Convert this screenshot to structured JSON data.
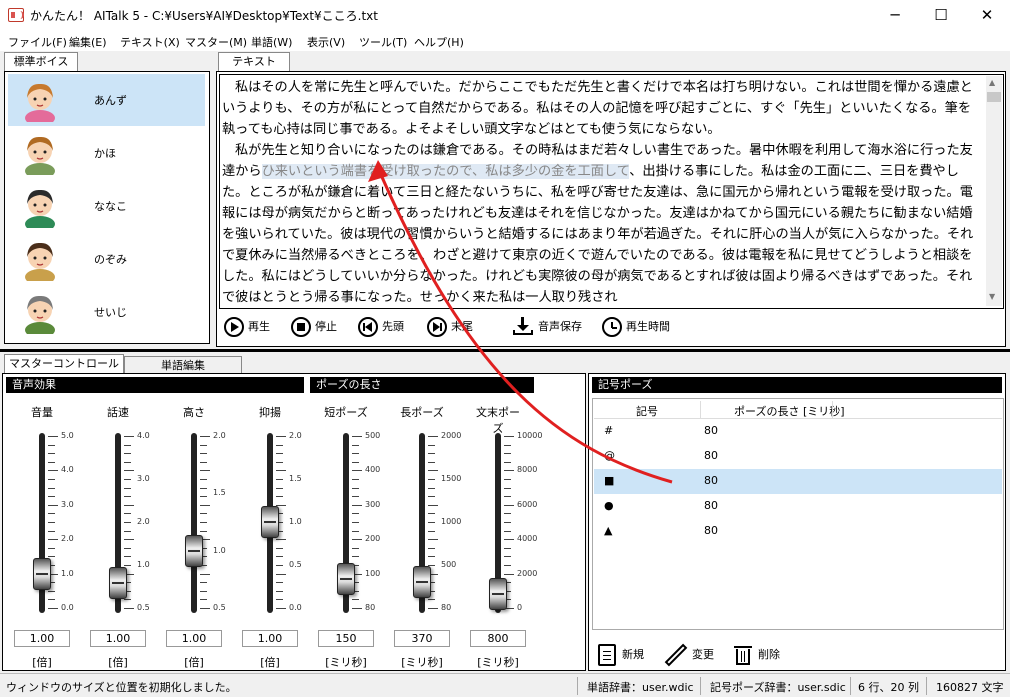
{
  "window": {
    "title": "かんたん！ AITalk 5 - C:¥Users¥AI¥Desktop¥Text¥こころ.txt",
    "app_icon": "speaker-icon",
    "controls": {
      "minimize": "─",
      "maximize": "☐",
      "close": "✕"
    }
  },
  "menu": [
    "ファイル(F)",
    "編集(E)",
    "テキスト(X)",
    "マスター(M)",
    "単語(W)",
    "表示(V)",
    "ツール(T)",
    "ヘルプ(H)"
  ],
  "voice_panel": {
    "tab": "標準ボイス",
    "voices": [
      {
        "name": "あんず",
        "selected": true,
        "hair": "#c77a2e",
        "face": "#f7d3b3",
        "cloth": "#e46b9a"
      },
      {
        "name": "かほ",
        "selected": false,
        "hair": "#b06a22",
        "face": "#f7d3b3",
        "cloth": "#7a9c5a"
      },
      {
        "name": "ななこ",
        "selected": false,
        "hair": "#2a2a2a",
        "face": "#f7d3b3",
        "cloth": "#2e8b57"
      },
      {
        "name": "のぞみ",
        "selected": false,
        "hair": "#4a2e1a",
        "face": "#f7d3b3",
        "cloth": "#c9a04b"
      },
      {
        "name": "せいじ",
        "selected": false,
        "hair": "#7a7a7a",
        "face": "#f7d3b3",
        "cloth": "#5a8a3a"
      }
    ]
  },
  "editor": {
    "tab": "テキスト",
    "paragraphs": [
      "私はその人を常に先生と呼んでいた。だからここでもただ先生と書くだけで本名は打ち明けない。これは世間を憚かる遠慮というよりも、その方が私にとって自然だからである。私はその人の記憶を呼び起すごとに、すぐ「先生」といいたくなる。筆を執っても心持は同じ事である。よそよそしい頭文字などはとても使う気にならない。",
      "私が先生と知り合いになったのは鎌倉である。その時私はまだ若々しい書生であった。暑中休暇を利用して海水浴に行った友達から",
      "ひ来いという端書を受け取ったので、私は多少の金を工面して",
      "、出掛ける事にした。私は金の工面に二、三日を費やした。ところが私が鎌倉に着いて三日と経たないうちに、私を呼び寄せた友達は、急に国元から帰れという電報を受け取った。電報には母が病気だからと断ってあったけれども友達はそれを信じなかった。友達はかねてから国元にいる親たちに勧まない結婚を強いられていた。彼は現代の習慣からいうと結婚するにはあまり年が若過ぎた。それに肝心の当人が気に入らなかった。それで夏休みに当然帰るべきところを、わざと避けて東京の近くで遊んでいたのである。彼は電報を私に見せてどうしようと相談をした。私にはどうしていいか分らなかった。けれども実際彼の母が病気であるとすれば彼は固より帰るべきはずであった。それで彼はとうとう帰る事になった。せっかく来た私は一人取り残され"
    ],
    "controls": [
      {
        "icon": "play-icon",
        "label": "再生"
      },
      {
        "icon": "stop-icon",
        "label": "停止"
      },
      {
        "icon": "skip-back-icon",
        "label": "先頭"
      },
      {
        "icon": "skip-forward-icon",
        "label": "末尾"
      },
      {
        "icon": "download-icon",
        "label": "音声保存"
      },
      {
        "icon": "timer-icon",
        "label": "再生時間"
      }
    ]
  },
  "master": {
    "tabs": [
      "マスターコントロール",
      "単語編集"
    ],
    "voice_effects_title": "音声効果",
    "pause_length_title": "ポーズの長さ",
    "sliders": [
      {
        "label": "音量",
        "value": "1.00",
        "unit": "[倍]",
        "min": 0,
        "max": 5,
        "level": 0.2,
        "scale": [
          "5.0",
          "4.0",
          "3.0",
          "2.0",
          "1.0",
          "0.0"
        ]
      },
      {
        "label": "話速",
        "value": "1.00",
        "unit": "[倍]",
        "min": 0.5,
        "max": 4,
        "level": 0.143,
        "scale": [
          "4.0",
          "3.0",
          "2.0",
          "1.0",
          "0.5"
        ]
      },
      {
        "label": "高さ",
        "value": "1.00",
        "unit": "[倍]",
        "min": 0.5,
        "max": 2,
        "level": 0.333,
        "scale": [
          "2.0",
          "1.5",
          "1.0",
          "0.5"
        ]
      },
      {
        "label": "抑揚",
        "value": "1.00",
        "unit": "[倍]",
        "min": 0,
        "max": 2,
        "level": 0.5,
        "scale": [
          "2.0",
          "1.5",
          "1.0",
          "0.5",
          "0.0"
        ]
      },
      {
        "label": "短ポーズ",
        "value": "150",
        "unit": "[ミリ秒]",
        "min": 80,
        "max": 500,
        "level": 0.167,
        "scale": [
          "500",
          "400",
          "300",
          "200",
          "100",
          "80"
        ]
      },
      {
        "label": "長ポーズ",
        "value": "370",
        "unit": "[ミリ秒]",
        "min": 80,
        "max": 2000,
        "level": 0.151,
        "scale": [
          "2000",
          "1500",
          "1000",
          "500",
          "80"
        ]
      },
      {
        "label": "文末ポーズ",
        "value": "800",
        "unit": "[ミリ秒]",
        "min": 0,
        "max": 10000,
        "level": 0.08,
        "scale": [
          "10000",
          "8000",
          "6000",
          "4000",
          "2000",
          "0"
        ]
      }
    ]
  },
  "symbol_pause": {
    "title": "記号ポーズ",
    "columns": [
      "記号",
      "ポーズの長さ [ミリ秒]"
    ],
    "rows": [
      {
        "symbol": "#",
        "length": "80",
        "selected": false
      },
      {
        "symbol": "@",
        "length": "80",
        "selected": false
      },
      {
        "symbol": "■",
        "length": "80",
        "selected": true
      },
      {
        "symbol": "●",
        "length": "80",
        "selected": false
      },
      {
        "symbol": "▲",
        "length": "80",
        "selected": false
      }
    ],
    "actions": [
      {
        "icon": "new-document-icon",
        "label": "新規"
      },
      {
        "icon": "pencil-icon",
        "label": "変更"
      },
      {
        "icon": "trash-icon",
        "label": "削除"
      }
    ]
  },
  "status": {
    "message": "ウィンドウのサイズと位置を初期化しました。",
    "word_dict": "単語辞書：user.wdic",
    "symbol_dict": "記号ポーズ辞書：user.sdic",
    "position": "6 行、20 列",
    "chars": "160827 文字"
  },
  "annotation_color": "#e02020"
}
